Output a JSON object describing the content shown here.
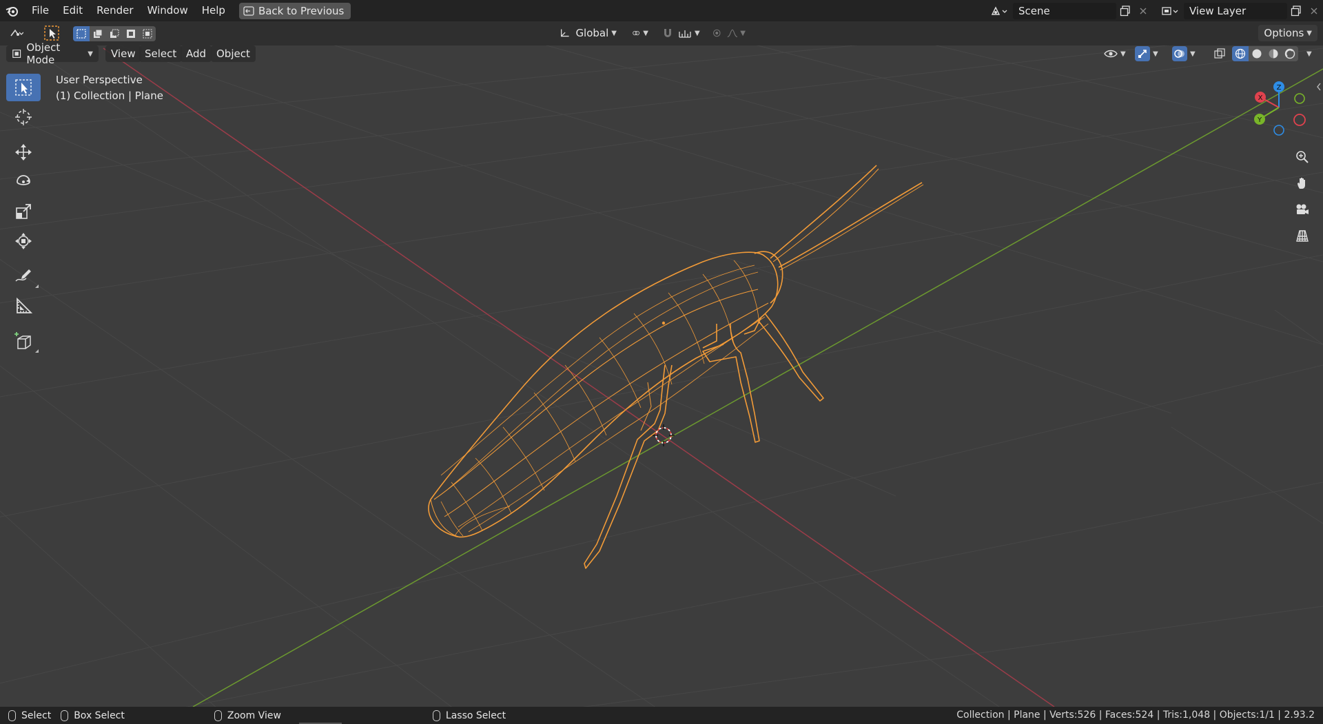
{
  "menubar": {
    "items": [
      "File",
      "Edit",
      "Render",
      "Window",
      "Help"
    ],
    "back_label": "Back to Previous",
    "scene": "Scene",
    "view_layer": "View Layer"
  },
  "tool_header": {
    "orientation": "Global",
    "options": "Options"
  },
  "view_header": {
    "mode": "Object Mode",
    "menus": [
      "View",
      "Select",
      "Add",
      "Object"
    ]
  },
  "viewport": {
    "perspective": "User Perspective",
    "collection": "(1) Collection | Plane",
    "gizmo": {
      "x": "X",
      "y": "Y",
      "z": "Z"
    }
  },
  "toolbar": {
    "tools": [
      "select-box-tool",
      "cursor-tool",
      "move-tool",
      "rotate-tool",
      "scale-tool",
      "transform-tool",
      "annotate-tool",
      "measure-tool",
      "add-cube-tool"
    ]
  },
  "statusbar": {
    "select": "Select",
    "box_select": "Box Select",
    "zoom_view": "Zoom View",
    "lasso_select": "Lasso Select",
    "stats": "Collection | Plane | Verts:526 | Faces:524 | Tris:1,048 | Objects:1/1 | 2.93.2"
  },
  "colors": {
    "accent": "#4772b3",
    "selection": "#f29b38",
    "x_axis": "#9c3c49",
    "y_axis": "#6c9a2f"
  }
}
